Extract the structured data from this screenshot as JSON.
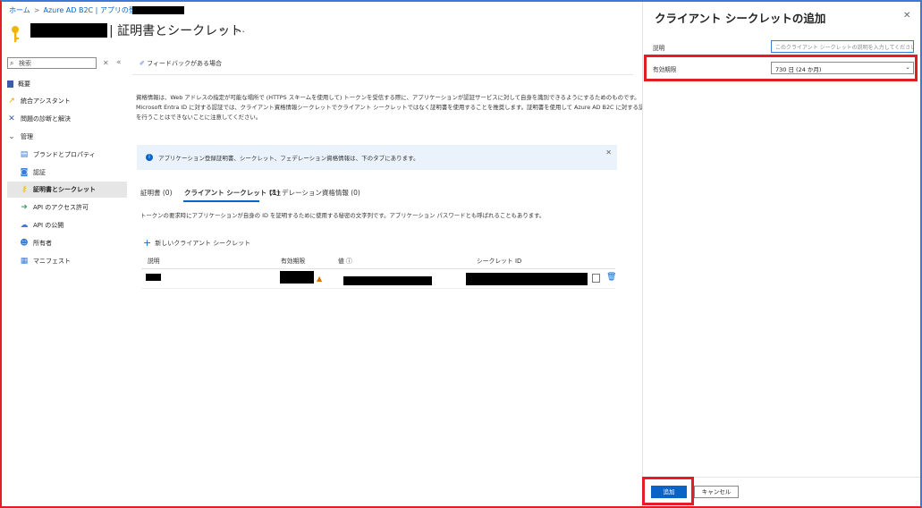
{
  "breadcrumb": {
    "home": "ホーム",
    "tenant": "Azure AD B2C | アプリの登録"
  },
  "page": {
    "title": "| 証明書とシークレット",
    "pin_icon": "pin-icon",
    "more": "…"
  },
  "sidebar": {
    "search_placeholder": "検索",
    "items": [
      {
        "label": "概要",
        "icon": "overview-icon"
      },
      {
        "label": "統合アシスタント",
        "icon": "rocket-icon"
      },
      {
        "label": "問題の診断と解決",
        "icon": "wrench-icon"
      },
      {
        "label": "管理",
        "icon": "chevron-down-icon"
      },
      {
        "label": "ブランドとプロパティ",
        "icon": "branding-icon"
      },
      {
        "label": "認証",
        "icon": "auth-icon"
      },
      {
        "label": "証明書とシークレット",
        "icon": "key-icon"
      },
      {
        "label": "API のアクセス許可",
        "icon": "permission-icon"
      },
      {
        "label": "API の公開",
        "icon": "cloud-icon"
      },
      {
        "label": "所有者",
        "icon": "owners-icon"
      },
      {
        "label": "マニフェスト",
        "icon": "manifest-icon"
      }
    ]
  },
  "main": {
    "feedback": "フィードバックがある場合",
    "description_line1": "資格情報は、Web アドレスの指定が可能な場所で (HTTPS スキームを使用して) トークンを受信する際に、アプリケーションが認証サービスに対して自身を識別できるようにするためのものです。",
    "description_line2": "Microsoft Entra ID に対する認証では、クライアント資格情報シークレットでクライアント シークレットではなく証明書を使用することを推奨します。証明書を使用して Azure AD B2C に対する認証",
    "description_line3": "を行うことはできないことに注意してください。",
    "info": "アプリケーション登録証明書、シークレット、フェデレーション資格情報は、下のタブにあります。",
    "tabs": [
      {
        "label": "証明書 (0)"
      },
      {
        "label": "クライアント シークレット (1)"
      },
      {
        "label": "フェデレーション資格情報 (0)"
      }
    ],
    "tab_description": "トークンの要求時にアプリケーションが自身の ID を証明するために使用する秘密の文字列です。アプリケーション パスワードとも呼ばれることもあります。",
    "new_secret": "新しいクライアント シークレット",
    "columns": [
      "説明",
      "有効期限",
      "値",
      "シークレット ID"
    ]
  },
  "panel": {
    "title": "クライアント シークレットの追加",
    "description_label": "説明",
    "description_placeholder": "このクライアント シークレットの説明を入力してください",
    "expiry_label": "有効期限",
    "expiry_value": "730 日 (24 か月)",
    "add_label": "追加",
    "cancel_label": "キャンセル"
  },
  "colors": {
    "accent": "#0a64c8",
    "highlight": "#e21d25"
  }
}
